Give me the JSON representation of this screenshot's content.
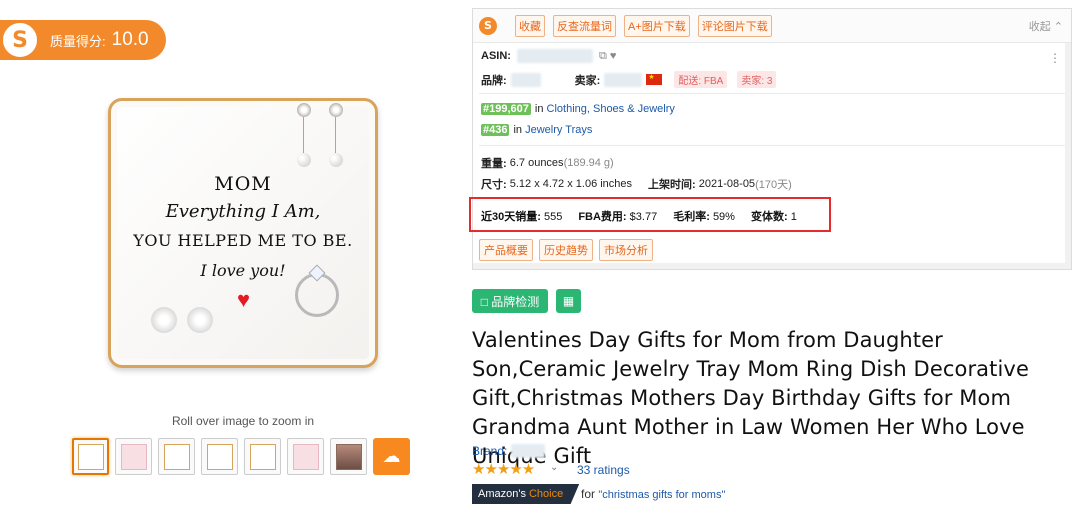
{
  "score": {
    "label": "质量得分:",
    "value": "10.0"
  },
  "product_image": {
    "line1": "MOM",
    "line2": "Everything I Am,",
    "line3": "YOU HELPED ME TO BE.",
    "line4": "I love you!"
  },
  "zoom_hint": "Roll over image to zoom in",
  "panel": {
    "tags": [
      "收藏",
      "反查流量词",
      "A+图片下载",
      "评论图片下载"
    ],
    "collapse": "收起 ⌃",
    "asin_label": "ASIN:",
    "brand_label": "品牌:",
    "seller_label": "卖家:",
    "fba_label": "配送: FBA",
    "sellers_count": "卖家: 3",
    "rank1": {
      "value": "#199,607",
      "in": "in",
      "category": "Clothing, Shoes & Jewelry"
    },
    "rank2": {
      "value": "#436",
      "in": "in",
      "category": "Jewelry Trays"
    },
    "weight_label": "重量:",
    "weight_value": "6.7 ounces",
    "weight_grams": "(189.94 g)",
    "size_label": "尺寸:",
    "size_value": "5.12 x 4.72 x 1.06 inches",
    "launch_label": "上架时间:",
    "launch_value": "2021-08-05",
    "launch_days": "(170天)",
    "stats": {
      "sales_label": "近30天销量:",
      "sales_value": "555",
      "fba_fee_label": "FBA费用:",
      "fba_fee_value": "$3.77",
      "margin_label": "毛利率:",
      "margin_value": "59%",
      "variants_label": "变体数:",
      "variants_value": "1"
    },
    "bottom_tabs": [
      "产品概要",
      "历史趋势",
      "市场分析"
    ]
  },
  "brand_check_label": "□ 品牌检测",
  "product_title": "Valentines Day Gifts for Mom from Daughter Son,Ceramic Jewelry Tray Mom Ring Dish Decorative Gift,Christmas Mothers Day Birthday Gifts for Mom Grandma Aunt Mother in Law Women Her Who Love Unique Gift",
  "brand_label": "Brand:",
  "rating": {
    "stars": 4.5,
    "count_text": "33 ratings"
  },
  "choice": {
    "prefix": "Amazon's",
    "word": "Choice",
    "for": "for",
    "keyword": "\"christmas gifts for moms\""
  },
  "colors": {
    "accent": "#f28a2b",
    "link": "#1d5aa8",
    "highlight": "#e52b2b",
    "green": "#2bb673"
  }
}
